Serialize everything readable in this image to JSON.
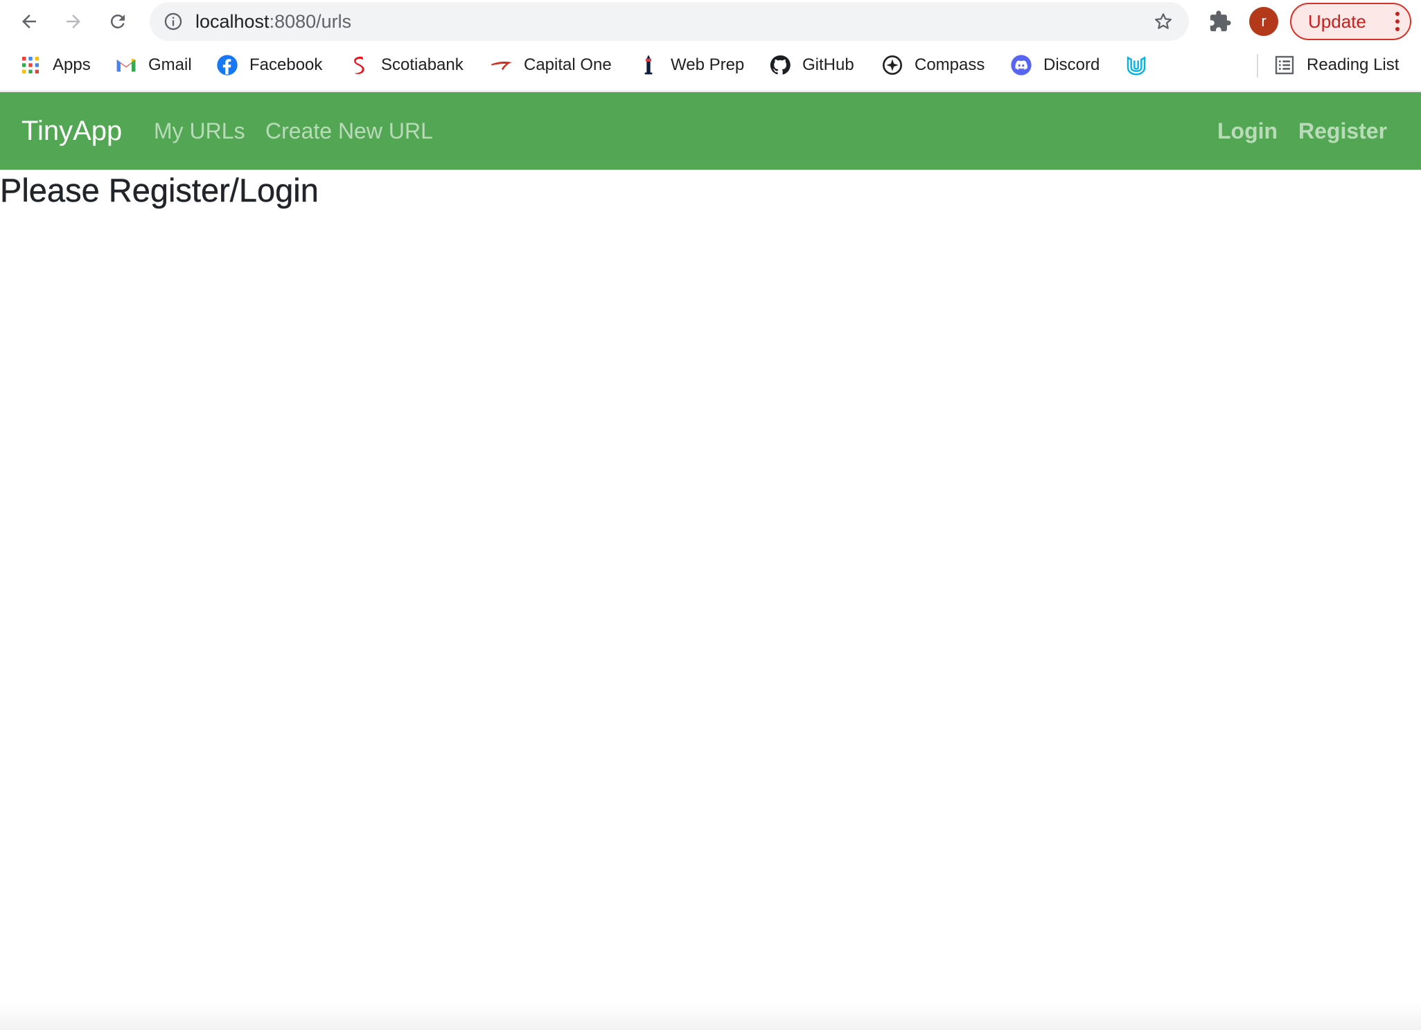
{
  "browser": {
    "url_host": "localhost",
    "url_rest": ":8080/urls",
    "avatar_initial": "r",
    "update_label": "Update",
    "bookmarks": [
      {
        "label": "Apps",
        "icon": "apps-grid-icon"
      },
      {
        "label": "Gmail",
        "icon": "gmail-icon"
      },
      {
        "label": "Facebook",
        "icon": "facebook-icon"
      },
      {
        "label": "Scotiabank",
        "icon": "scotiabank-icon"
      },
      {
        "label": "Capital One",
        "icon": "capital-one-icon"
      },
      {
        "label": "Web Prep",
        "icon": "web-prep-icon"
      },
      {
        "label": "GitHub",
        "icon": "github-icon"
      },
      {
        "label": "Compass",
        "icon": "compass-icon"
      },
      {
        "label": "Discord",
        "icon": "discord-icon"
      },
      {
        "label": "",
        "icon": "udacity-icon"
      }
    ],
    "reading_list_label": "Reading List"
  },
  "navbar": {
    "brand": "TinyApp",
    "links": {
      "my_urls": "My URLs",
      "create_new": "Create New URL",
      "login": "Login",
      "register": "Register"
    },
    "background_color": "#53a653"
  },
  "main": {
    "heading": "Please Register/Login"
  }
}
